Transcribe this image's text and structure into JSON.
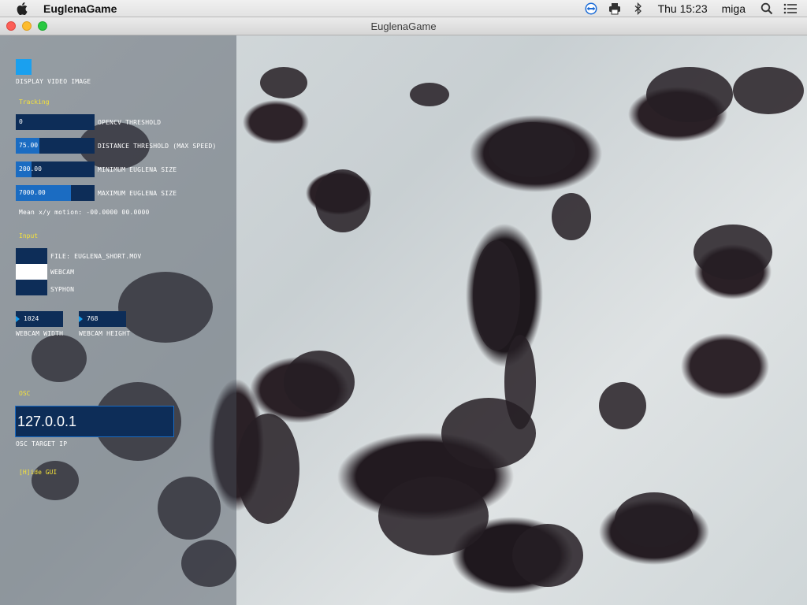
{
  "menubar": {
    "app_name": "EuglenaGame",
    "clock": "Thu 15:23",
    "user": "miga",
    "icons": [
      "apple-icon",
      "teamviewer-icon",
      "print-icon",
      "bluetooth-icon",
      "search-icon",
      "list-icon"
    ]
  },
  "window": {
    "title": "EuglenaGame"
  },
  "gui": {
    "display_video_label": "DISPLAY VIDEO IMAGE",
    "display_video_on": true,
    "tracking_section": "Tracking",
    "sliders": [
      {
        "label": "OPENCV THRESHOLD",
        "value": "0",
        "fraction": 0.0
      },
      {
        "label": "DISTANCE THRESHOLD (MAX SPEED)",
        "value": "75.00",
        "fraction": 0.3
      },
      {
        "label": "MINIMUM EUGLENA SIZE",
        "value": "200.00",
        "fraction": 0.2
      },
      {
        "label": "MAXIMUM EUGLENA SIZE",
        "value": "7000.00",
        "fraction": 0.7
      }
    ],
    "motion_text": "Mean x/y motion: -00.0000  00.0000",
    "input_section": "Input",
    "inputs": [
      {
        "label": "FILE: EUGLENA_SHORT.MOV",
        "selected": false
      },
      {
        "label": "WEBCAM",
        "selected": true
      },
      {
        "label": "SYPHON",
        "selected": false
      }
    ],
    "webcam_width": {
      "label": "WEBCAM WIDTH",
      "value": "1024"
    },
    "webcam_height": {
      "label": "WEBCAM HEIGHT",
      "value": "768"
    },
    "osc_section": "OSC",
    "osc_ip": "127.0.0.1",
    "osc_ip_label": "OSC TARGET IP",
    "hide_gui": "[H]ide GUI"
  },
  "colors": {
    "panel_dark": "#0d2d58",
    "slider_fill": "#1b6cc2",
    "accent": "#1aa0ef",
    "section_label": "#f5e23a"
  }
}
